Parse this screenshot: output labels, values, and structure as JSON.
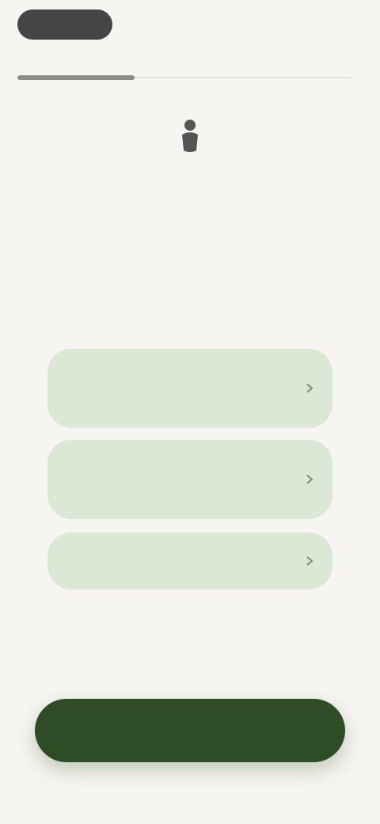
{
  "header": {
    "back_label": "",
    "progress": 0.35
  },
  "step": {
    "icon": "person-icon",
    "label": "",
    "headline": "",
    "subtitle": ""
  },
  "options": [
    {
      "label": "",
      "icon": "chevron-right-icon"
    },
    {
      "label": "",
      "icon": "chevron-right-icon"
    },
    {
      "label": "",
      "icon": "chevron-right-icon"
    }
  ],
  "secondary_link": "",
  "primary_button": "",
  "colors": {
    "background": "#f6f5f1",
    "option_bg": "#dce8d6",
    "primary": "#2e4d26"
  }
}
